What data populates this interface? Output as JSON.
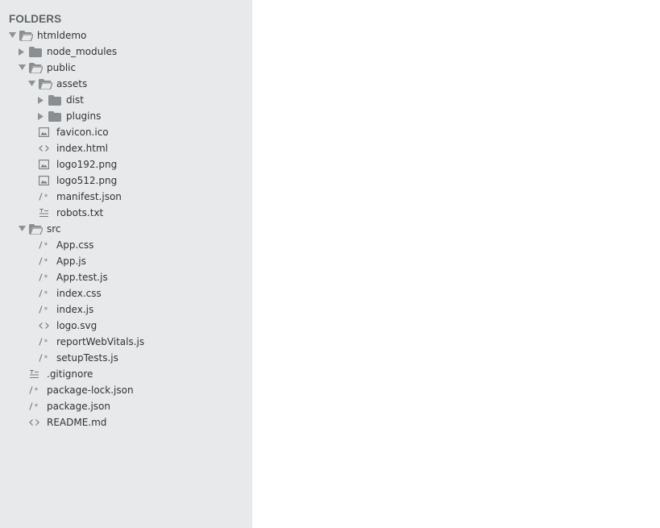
{
  "sidebar": {
    "header": "FOLDERS",
    "items": [
      {
        "label": "htmldemo",
        "depth": 0,
        "kind": "folder",
        "state": "open"
      },
      {
        "label": "node_modules",
        "depth": 1,
        "kind": "folder",
        "state": "closed"
      },
      {
        "label": "public",
        "depth": 1,
        "kind": "folder",
        "state": "open"
      },
      {
        "label": "assets",
        "depth": 2,
        "kind": "folder",
        "state": "open"
      },
      {
        "label": "dist",
        "depth": 3,
        "kind": "folder",
        "state": "closed"
      },
      {
        "label": "plugins",
        "depth": 3,
        "kind": "folder",
        "state": "closed"
      },
      {
        "label": "favicon.ico",
        "depth": 2,
        "kind": "file",
        "icon": "image-file-icon"
      },
      {
        "label": "index.html",
        "depth": 2,
        "kind": "file",
        "icon": "code-file-icon"
      },
      {
        "label": "logo192.png",
        "depth": 2,
        "kind": "file",
        "icon": "image-file-icon"
      },
      {
        "label": "logo512.png",
        "depth": 2,
        "kind": "file",
        "icon": "image-file-icon"
      },
      {
        "label": "manifest.json",
        "depth": 2,
        "kind": "file",
        "icon": "comment-file-icon"
      },
      {
        "label": "robots.txt",
        "depth": 2,
        "kind": "file",
        "icon": "text-file-icon"
      },
      {
        "label": "src",
        "depth": 1,
        "kind": "folder",
        "state": "open"
      },
      {
        "label": "App.css",
        "depth": 2,
        "kind": "file",
        "icon": "comment-file-icon"
      },
      {
        "label": "App.js",
        "depth": 2,
        "kind": "file",
        "icon": "comment-file-icon"
      },
      {
        "label": "App.test.js",
        "depth": 2,
        "kind": "file",
        "icon": "comment-file-icon"
      },
      {
        "label": "index.css",
        "depth": 2,
        "kind": "file",
        "icon": "comment-file-icon"
      },
      {
        "label": "index.js",
        "depth": 2,
        "kind": "file",
        "icon": "comment-file-icon"
      },
      {
        "label": "logo.svg",
        "depth": 2,
        "kind": "file",
        "icon": "code-file-icon"
      },
      {
        "label": "reportWebVitals.js",
        "depth": 2,
        "kind": "file",
        "icon": "comment-file-icon"
      },
      {
        "label": "setupTests.js",
        "depth": 2,
        "kind": "file",
        "icon": "comment-file-icon"
      },
      {
        "label": ".gitignore",
        "depth": 1,
        "kind": "file",
        "icon": "text-file-icon"
      },
      {
        "label": "package-lock.json",
        "depth": 1,
        "kind": "file",
        "icon": "comment-file-icon"
      },
      {
        "label": "package.json",
        "depth": 1,
        "kind": "file",
        "icon": "comment-file-icon"
      },
      {
        "label": "README.md",
        "depth": 1,
        "kind": "file",
        "icon": "code-file-icon"
      }
    ]
  },
  "colors": {
    "sidebar_bg": "#e7e9ea",
    "text": "#333333",
    "icon": "#8a8e90",
    "header": "#5f6365"
  }
}
